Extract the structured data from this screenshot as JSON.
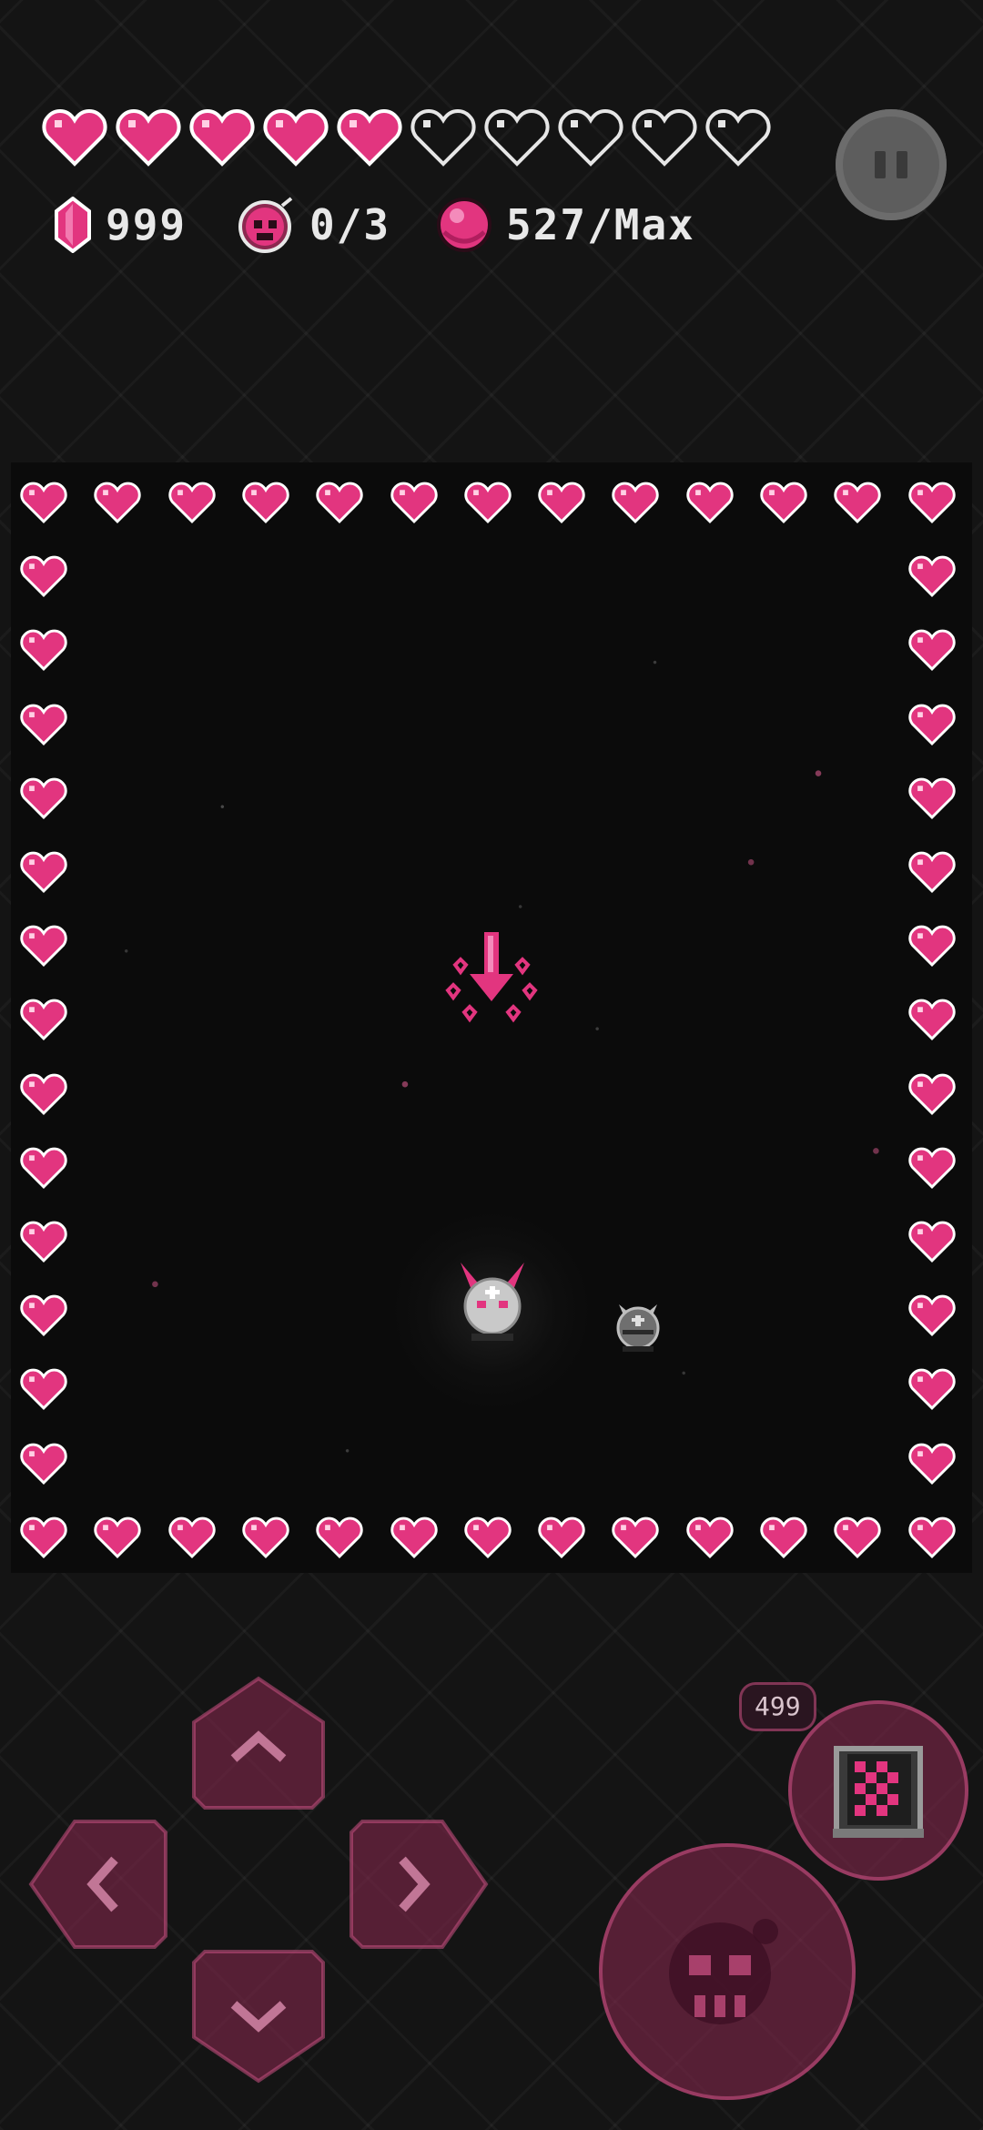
{
  "hud": {
    "hearts_total": 10,
    "hearts_filled": 5,
    "gems_value": "999",
    "bombs_value": "0/3",
    "orbs_value": "527/Max"
  },
  "controls": {
    "map_count": "499"
  },
  "colors": {
    "heart_pink": "#e2357f",
    "ui_pink": "#8c2850",
    "background": "#141414",
    "arena": "#0b0b0b"
  },
  "icons": {
    "hud": [
      "heart-icon",
      "gem-icon",
      "bomb-icon",
      "orb-icon",
      "pause-icon"
    ],
    "controls": [
      "arrow-up-icon",
      "arrow-down-icon",
      "arrow-left-icon",
      "arrow-right-icon",
      "skull-bomb-icon",
      "map-icon"
    ]
  }
}
